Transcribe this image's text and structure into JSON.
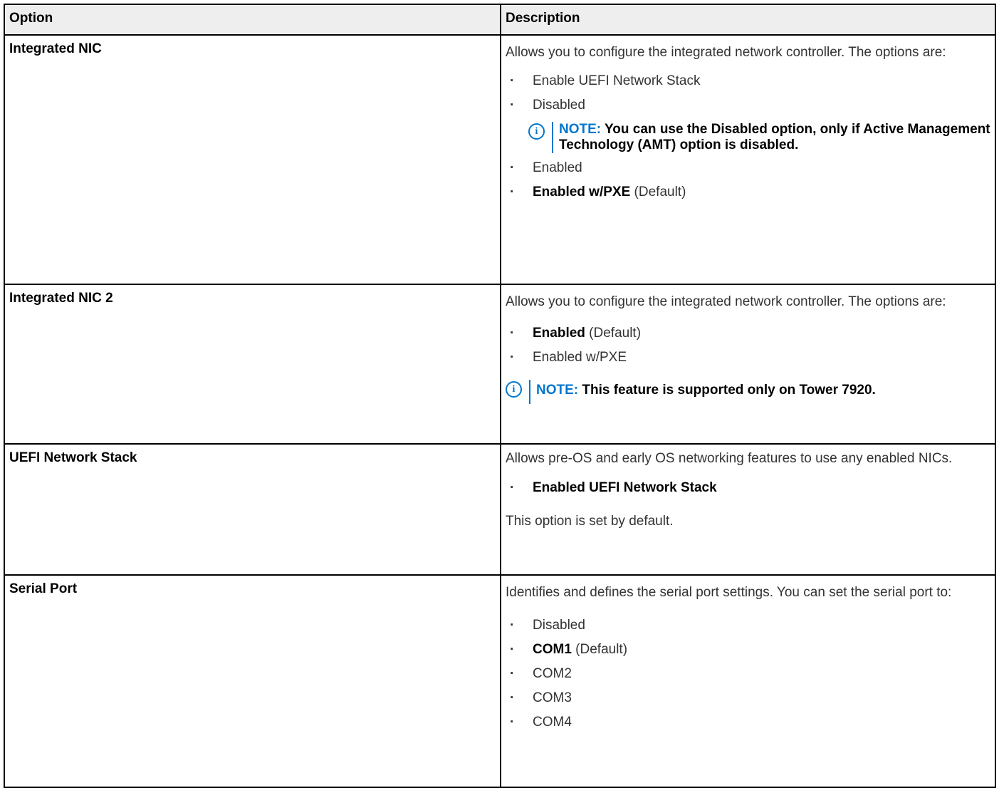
{
  "headers": {
    "option": "Option",
    "description": "Description"
  },
  "rows": [
    {
      "option": "Integrated NIC",
      "desc": "Allows you to configure the integrated network controller. The options are:",
      "items": [
        {
          "bold": "",
          "text": "Enable UEFI Network Stack"
        },
        {
          "bold": "",
          "text": "Disabled"
        }
      ],
      "note": {
        "label": "NOTE:",
        "text": " You can use the Disabled option, only if Active Management Technology (AMT) option is disabled."
      },
      "items2": [
        {
          "bold": "",
          "text": "Enabled"
        },
        {
          "bold": "Enabled w/PXE",
          "text": " (Default)"
        }
      ]
    },
    {
      "option": "Integrated NIC 2",
      "desc": "Allows you to configure the integrated network controller. The options are:",
      "items": [
        {
          "bold": "Enabled",
          "text": " (Default)"
        },
        {
          "bold": "",
          "text": "Enabled w/PXE"
        }
      ],
      "note": {
        "label": "NOTE:",
        "text": " This feature is supported only on Tower 7920."
      }
    },
    {
      "option": "UEFI Network Stack",
      "desc": "Allows pre-OS and early OS networking features to use any enabled NICs.",
      "items": [
        {
          "bold": "Enabled UEFI Network Stack",
          "text": ""
        }
      ],
      "footer": "This option is set by default."
    },
    {
      "option": "Serial Port",
      "desc": "Identifies and defines the serial port settings. You can set the serial port to:",
      "items": [
        {
          "bold": "",
          "text": "Disabled"
        },
        {
          "bold": "COM1",
          "text": " (Default)"
        },
        {
          "bold": "",
          "text": "COM2"
        },
        {
          "bold": "",
          "text": "COM3"
        },
        {
          "bold": "",
          "text": "COM4"
        }
      ]
    }
  ],
  "icons": {
    "note": "info-circle-icon",
    "note_glyph": "i"
  },
  "colors": {
    "note_accent": "#0076ce",
    "header_bg": "#eeeeee"
  }
}
